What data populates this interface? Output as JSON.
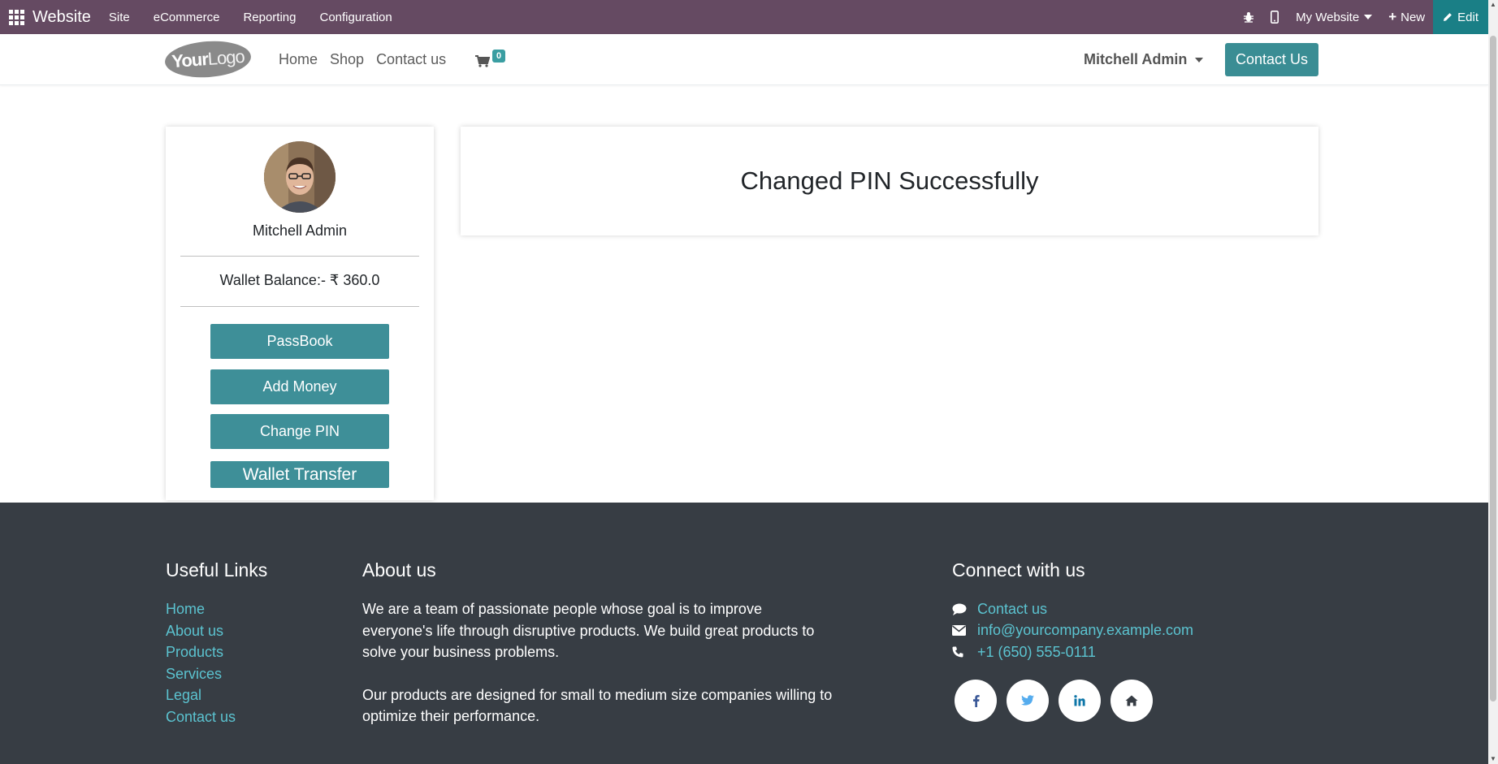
{
  "adminbar": {
    "brand": "Website",
    "menu": [
      "Site",
      "eCommerce",
      "Reporting",
      "Configuration"
    ],
    "my_website": "My Website",
    "new_label": "New",
    "edit_label": "Edit",
    "icons": [
      "apps-grid-icon",
      "bug-icon",
      "mobile-icon"
    ]
  },
  "header": {
    "logo_text_bold": "Your",
    "logo_text_light": "Logo",
    "nav": [
      "Home",
      "Shop",
      "Contact us"
    ],
    "cart_count": "0",
    "user_name": "Mitchell Admin",
    "contact_button": "Contact Us"
  },
  "sidebar": {
    "user_name": "Mitchell Admin",
    "wallet_balance": "Wallet Balance:- ₹ 360.0",
    "buttons": [
      "PassBook",
      "Add Money",
      "Change PIN",
      "Wallet Transfer"
    ]
  },
  "main": {
    "message": "Changed PIN Successfully"
  },
  "footer": {
    "useful_links": {
      "title": "Useful Links",
      "links": [
        "Home",
        "About us",
        "Products",
        "Services",
        "Legal",
        "Contact us"
      ]
    },
    "about": {
      "title": "About us",
      "p1": "We are a team of passionate people whose goal is to improve everyone's life through disruptive products. We build great products to solve your business problems.",
      "p2": "Our products are designed for small to medium size companies willing to optimize their performance."
    },
    "connect": {
      "title": "Connect with us",
      "contact": "Contact us",
      "email": "info@yourcompany.example.com",
      "phone": "+1 (650) 555-0111",
      "socials": [
        "facebook-icon",
        "twitter-icon",
        "linkedin-icon",
        "home-icon"
      ]
    }
  },
  "colors": {
    "adminbar": "#654a62",
    "edit_button": "#1a7f86",
    "primary": "#3e8f98",
    "footer_bg": "#373d44",
    "footer_link": "#5bc3d0"
  }
}
